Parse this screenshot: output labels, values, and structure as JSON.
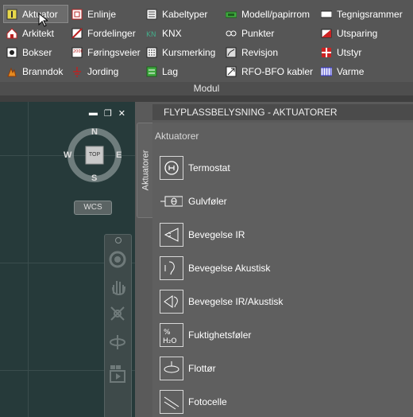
{
  "ribbon": {
    "group_label": "Modul",
    "buttons": [
      {
        "label": "Aktuator",
        "icon": "actuator-icon"
      },
      {
        "label": "Enlinje",
        "icon": "single-line-icon"
      },
      {
        "label": "Kabeltyper",
        "icon": "cable-types-icon"
      },
      {
        "label": "Modell/papirrom",
        "icon": "model-paper-space-icon"
      },
      {
        "label": "Tegnigsrammer",
        "icon": "drawing-frame-icon"
      },
      {
        "label": "Arkitekt",
        "icon": "architect-icon"
      },
      {
        "label": "Fordelinger",
        "icon": "distribution-icon"
      },
      {
        "label": "KNX",
        "icon": "knx-icon"
      },
      {
        "label": "Punkter",
        "icon": "points-icon"
      },
      {
        "label": "Utsparing",
        "icon": "recess-icon"
      },
      {
        "label": "Bokser",
        "icon": "boxes-icon"
      },
      {
        "label": "Føringsveier",
        "icon": "cable-route-icon"
      },
      {
        "label": "Kursmerking",
        "icon": "circuit-marking-icon"
      },
      {
        "label": "Revisjon",
        "icon": "revision-icon"
      },
      {
        "label": "Utstyr",
        "icon": "equipment-icon"
      },
      {
        "label": "Branndok",
        "icon": "fire-doc-icon"
      },
      {
        "label": "Jording",
        "icon": "grounding-icon"
      },
      {
        "label": "Lag",
        "icon": "layers-icon"
      },
      {
        "label": "RFO-BFO kabler",
        "icon": "rfo-bfo-cables-icon"
      },
      {
        "label": "Varme",
        "icon": "heating-icon"
      }
    ]
  },
  "viewport": {
    "viewcube": {
      "north": "N",
      "south": "S",
      "east": "E",
      "west": "W",
      "face": "TOP"
    },
    "wcs_label": "WCS"
  },
  "palette": {
    "title": "FLYPLASSBELYSNING - AKTUATORER",
    "tab_label": "Aktuatorer",
    "section_label": "Aktuatorer",
    "tools": [
      {
        "label": "Termostat",
        "icon": "thermostat-icon"
      },
      {
        "label": "Gulvføler",
        "icon": "floor-sensor-icon"
      },
      {
        "label": "Bevegelse IR",
        "icon": "motion-ir-icon"
      },
      {
        "label": "Bevegelse Akustisk",
        "icon": "motion-acoustic-icon"
      },
      {
        "label": "Bevegelse IR/Akustisk",
        "icon": "motion-ir-acoustic-icon"
      },
      {
        "label": "Fuktighetsføler",
        "icon": "humidity-sensor-icon"
      },
      {
        "label": "Flottør",
        "icon": "float-icon"
      },
      {
        "label": "Fotocelle",
        "icon": "photocell-icon"
      }
    ]
  }
}
